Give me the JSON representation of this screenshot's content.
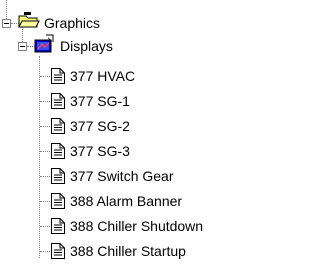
{
  "tree": {
    "graphics": {
      "label": "Graphics",
      "icon": "open-folder-icon",
      "expanded": true
    },
    "displays": {
      "label": "Displays",
      "icon": "displays-folder-icon",
      "expanded": true,
      "items": [
        {
          "label": "377 HVAC",
          "icon": "document-icon"
        },
        {
          "label": "377 SG-1",
          "icon": "document-icon"
        },
        {
          "label": "377 SG-2",
          "icon": "document-icon"
        },
        {
          "label": "377 SG-3",
          "icon": "document-icon"
        },
        {
          "label": "377 Switch Gear",
          "icon": "document-icon"
        },
        {
          "label": "388 Alarm Banner",
          "icon": "document-icon"
        },
        {
          "label": "388 Chiller Shutdown",
          "icon": "document-icon"
        },
        {
          "label": "388 Chiller Startup",
          "icon": "document-icon"
        }
      ]
    },
    "colors": {
      "folder_yellow": "#ffff80",
      "folder_outline": "#000000",
      "display_blue": "#0000c0",
      "connector": "#808080"
    }
  }
}
